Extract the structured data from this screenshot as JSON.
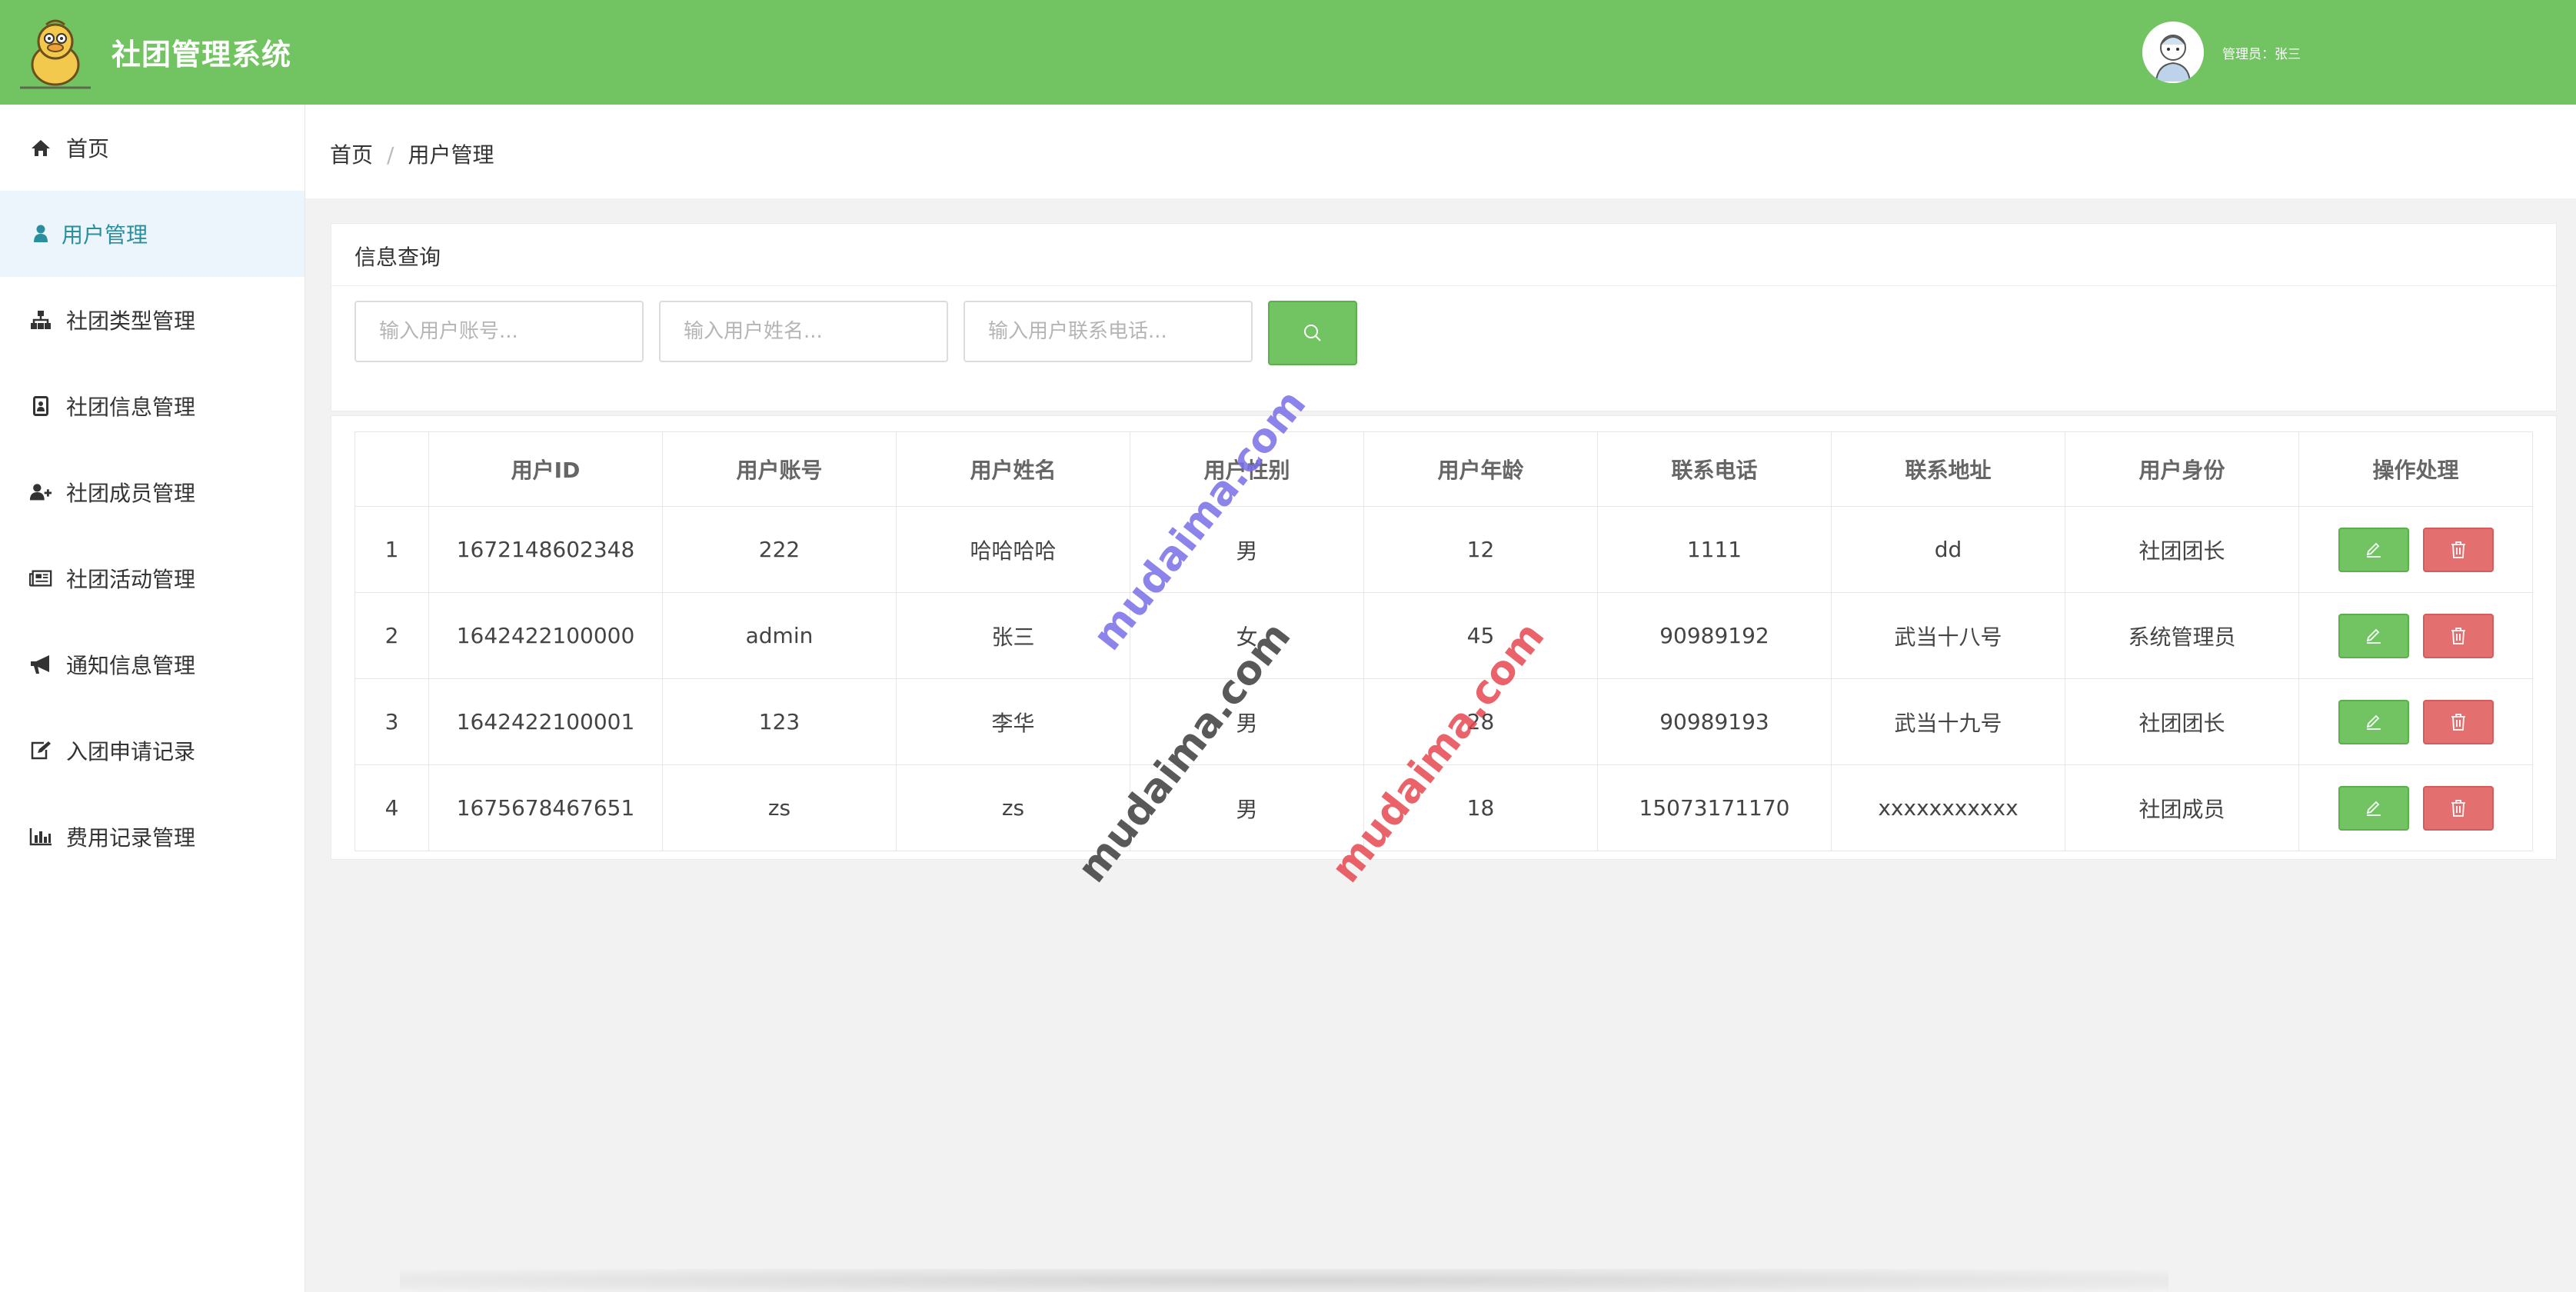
{
  "app": {
    "title": "社团管理系统",
    "admin_label": "管理员：张三"
  },
  "colors": {
    "header": "#72c462",
    "active_nav_bg": "#ecf5fc",
    "active_nav_text": "#2a8f9c",
    "delete": "#e46f6f"
  },
  "sidebar": {
    "items": [
      {
        "label": "首页",
        "icon": "home-icon"
      },
      {
        "label": "用户管理",
        "icon": "user-icon"
      },
      {
        "label": "社团类型管理",
        "icon": "sitemap-icon"
      },
      {
        "label": "社团信息管理",
        "icon": "id-card-icon"
      },
      {
        "label": "社团成员管理",
        "icon": "user-plus-icon"
      },
      {
        "label": "社团活动管理",
        "icon": "newspaper-icon"
      },
      {
        "label": "通知信息管理",
        "icon": "bullhorn-icon"
      },
      {
        "label": "入团申请记录",
        "icon": "edit-icon"
      },
      {
        "label": "费用记录管理",
        "icon": "bar-chart-icon"
      }
    ],
    "active_index": 1
  },
  "breadcrumb": {
    "home": "首页",
    "sep": "/",
    "current": "用户管理"
  },
  "search": {
    "title": "信息查询",
    "account_placeholder": "输入用户账号...",
    "name_placeholder": "输入用户姓名...",
    "phone_placeholder": "输入用户联系电话..."
  },
  "table": {
    "headers": {
      "index": "",
      "id": "用户ID",
      "account": "用户账号",
      "name": "用户姓名",
      "gender": "用户性别",
      "age": "用户年龄",
      "phone": "联系电话",
      "address": "联系地址",
      "role": "用户身份",
      "ops": "操作处理"
    },
    "rows": [
      {
        "index": "1",
        "id": "1672148602348",
        "account": "222",
        "name": "哈哈哈哈",
        "gender": "男",
        "age": "12",
        "phone": "1111",
        "address": "dd",
        "role": "社团团长"
      },
      {
        "index": "2",
        "id": "1642422100000",
        "account": "admin",
        "name": "张三",
        "gender": "女",
        "age": "45",
        "phone": "90989192",
        "address": "武当十八号",
        "role": "系统管理员"
      },
      {
        "index": "3",
        "id": "1642422100001",
        "account": "123",
        "name": "李华",
        "gender": "男",
        "age": "28",
        "phone": "90989193",
        "address": "武当十九号",
        "role": "社团团长"
      },
      {
        "index": "4",
        "id": "1675678467651",
        "account": "zs",
        "name": "zs",
        "gender": "男",
        "age": "18",
        "phone": "15073171170",
        "address": "xxxxxxxxxxx",
        "role": "社团成员"
      }
    ]
  },
  "watermark": {
    "text": "mudaima.com"
  }
}
